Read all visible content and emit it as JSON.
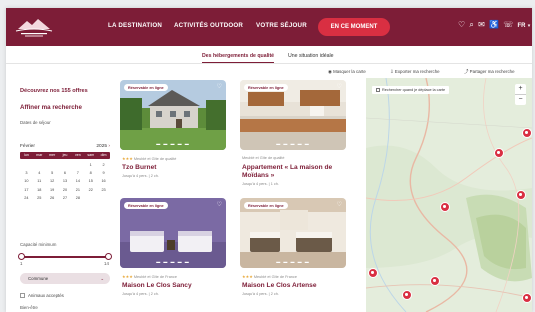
{
  "nav": {
    "items": [
      "LA DESTINATION",
      "ACTIVITÉS OUTDOOR",
      "VOTRE SÉJOUR"
    ],
    "cta": "EN CE MOMENT",
    "lang": "FR"
  },
  "subnav": {
    "tabs": [
      "Des hébergements de qualité",
      "Une situation idéale"
    ]
  },
  "actions": [
    "Masquer la carte",
    "Exporter ma recherche",
    "Partager ma recherche"
  ],
  "sidebar": {
    "found": "Découvrez nos 155 offres",
    "refine": "Affiner ma recherche",
    "dates_label": "Dates de séjour",
    "calendar": {
      "month": "Février",
      "year": "2025",
      "days": [
        "lun",
        "mar",
        "mer",
        "jeu",
        "ven",
        "sam",
        "dim"
      ],
      "dates": [
        "",
        "",
        "",
        "",
        "",
        "1",
        "2",
        "3",
        "4",
        "5",
        "6",
        "7",
        "8",
        "9",
        "10",
        "11",
        "12",
        "13",
        "14",
        "15",
        "16",
        "17",
        "18",
        "19",
        "20",
        "21",
        "22",
        "23",
        "24",
        "25",
        "26",
        "27",
        "28",
        ""
      ]
    },
    "capacity_label": "Capacité minimum",
    "capacity_min": "1",
    "capacity_max": "14",
    "commune_select": "Commune",
    "animals": "Animaux acceptés",
    "bottom_label": "Bien-être"
  },
  "badge": "Réservable en ligne",
  "cards": [
    {
      "stars": "★★★",
      "meta": "Meublé et Gîte de qualité",
      "name": "Tzo Burnet",
      "desc": "Jusqu'à 4 pers. | 2 ch."
    },
    {
      "stars": "",
      "meta": "Meublé et Gîte de qualité",
      "name": "Appartement « La maison de Moïdans »",
      "desc": "Jusqu'à 4 pers. | 1 ch."
    },
    {
      "stars": "★★★",
      "meta": "Meublé et Gîte de France",
      "name": "Maison Le Clos Sancy",
      "desc": "Jusqu'à 4 pers. | 2 ch."
    },
    {
      "stars": "★★★",
      "meta": "Meublé et Gîte de France",
      "name": "Maison Le Clos Artense",
      "desc": "Jusqu'à 4 pers. | 2 ch."
    }
  ],
  "map": {
    "checkbox": "Rechercher quand je déplace la carte",
    "zoom_in": "+",
    "zoom_out": "−"
  },
  "colors": {
    "brand": "#7d1d37",
    "accent": "#d92f42"
  }
}
